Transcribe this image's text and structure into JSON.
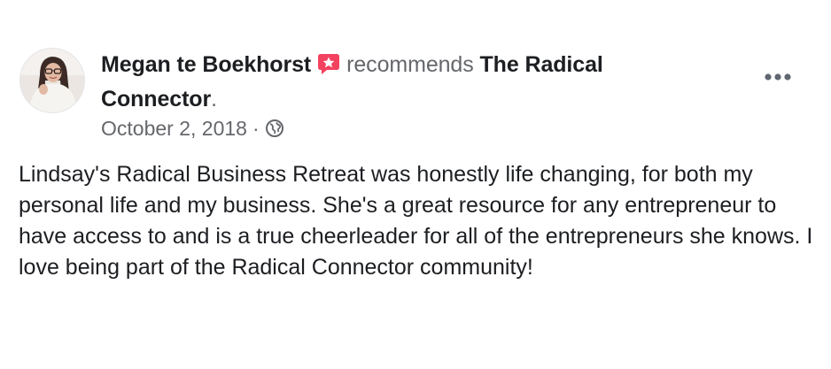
{
  "post": {
    "author": "Megan te Boekhorst",
    "action": "recommends",
    "page_name": "The Radical Connector",
    "period": ".",
    "date": "October 2, 2018",
    "separator": "·",
    "audience_icon": "globe-icon",
    "badge_icon": "recommendation-badge-icon",
    "more_icon": "more-options-icon",
    "text": "Lindsay's Radical Business Retreat was honestly life changing, for both my personal life and my business. She's a great resource for any entrepreneur to have access to and is a true cheerleader for all of the entrepreneurs she knows. I love being part of the Radical Connector community!"
  },
  "colors": {
    "primary_text": "#1c1e21",
    "secondary_text": "#65676b",
    "badge": "#f3425f"
  }
}
